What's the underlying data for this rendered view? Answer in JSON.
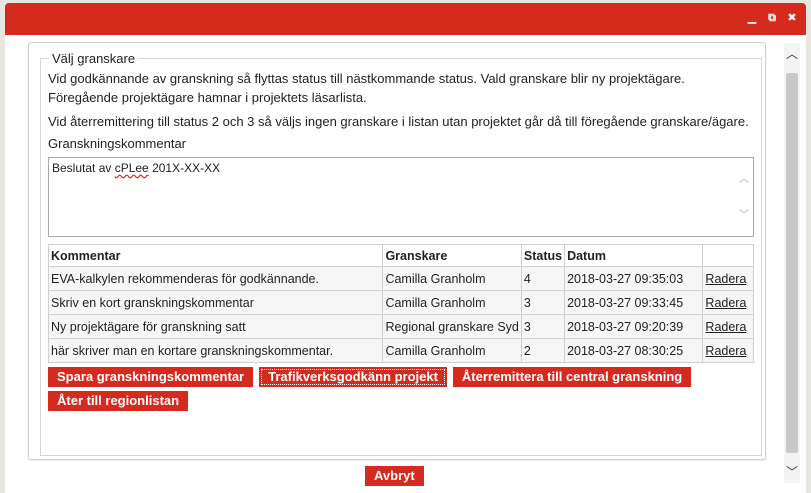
{
  "window": {
    "accent_color": "#d52b1e",
    "controls": [
      {
        "name": "minimize-icon",
        "glyph": "▁"
      },
      {
        "name": "restore-icon",
        "glyph": "⧉"
      },
      {
        "name": "close-icon",
        "glyph": "✖"
      }
    ]
  },
  "section": {
    "legend": "Välj granskare",
    "paragraph1": "Vid godkännande av granskning så flyttas status till nästkommande status. Vald granskare blir ny projektägare. Föregående projektägare hamnar i projektets läsarlista.",
    "paragraph2": "Vid återremittering till status 2 och 3 så väljs ingen granskare i listan utan projektet går då till föregående granskare/ägare.",
    "comment_label": "Granskningskommentar",
    "comment_prefix": "Beslutat av ",
    "comment_misspelled": "cPLee",
    "comment_suffix": " 201X-XX-XX"
  },
  "table": {
    "headers": [
      "Kommentar",
      "Granskare",
      "Status",
      "Datum",
      ""
    ],
    "rows": [
      {
        "comment": "EVA-kalkylen rekommenderas för godkännande.",
        "reviewer": "Camilla Granholm",
        "status": "4",
        "date": "2018-03-27 09:35:03",
        "action": "Radera"
      },
      {
        "comment": "Skriv en kort granskningskommentar",
        "reviewer": "Camilla Granholm",
        "status": "3",
        "date": "2018-03-27 09:33:45",
        "action": "Radera"
      },
      {
        "comment": "Ny projektägare för granskning satt",
        "reviewer": "Regional granskare Syd",
        "status": "3",
        "date": "2018-03-27 09:20:39",
        "action": "Radera"
      },
      {
        "comment": "här skriver man en kortare granskningskommentar.",
        "reviewer": "Camilla Granholm",
        "status": "2",
        "date": "2018-03-27 08:30:25",
        "action": "Radera"
      }
    ]
  },
  "buttons": {
    "save_comment": "Spara granskningskommentar",
    "approve": "Trafikverksgodkänn projekt",
    "remit": "Återremittera till central granskning",
    "back": "Åter till regionlistan",
    "cancel": "Avbryt"
  },
  "scrollbar": {
    "up_glyph": "︿",
    "down_glyph": "﹀"
  }
}
